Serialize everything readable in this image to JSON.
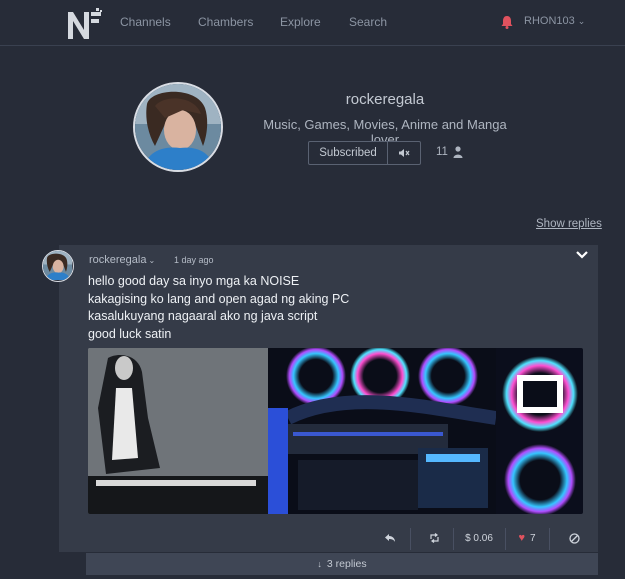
{
  "nav": {
    "links": [
      "Channels",
      "Chambers",
      "Explore",
      "Search"
    ],
    "username": "RHON103"
  },
  "channel": {
    "name": "rockeregala",
    "description": "Music, Games, Movies, Anime and Manga lover",
    "subscribe_label": "Subscribed",
    "subscribers": "11"
  },
  "show_replies": "Show replies",
  "post": {
    "author": "rockeregala",
    "time": "1 day ago",
    "lines": [
      "hello good day sa inyo mga ka NOISE",
      "kakagising ko lang and open agad ng aking PC",
      "kasalukuyang nagaaral ako ng java script",
      "good luck satin"
    ],
    "tip": "$ 0.06",
    "likes": "7",
    "replies": "3 replies"
  },
  "colors": {
    "background": "#272c38",
    "card": "#353b48",
    "accent_red": "#e0525e"
  },
  "icons": [
    "logo-n",
    "bell-icon",
    "mute-icon",
    "person-icon",
    "chevron-down-icon",
    "reply-icon",
    "repost-icon",
    "heart-icon",
    "block-icon",
    "arrow-down-icon"
  ]
}
